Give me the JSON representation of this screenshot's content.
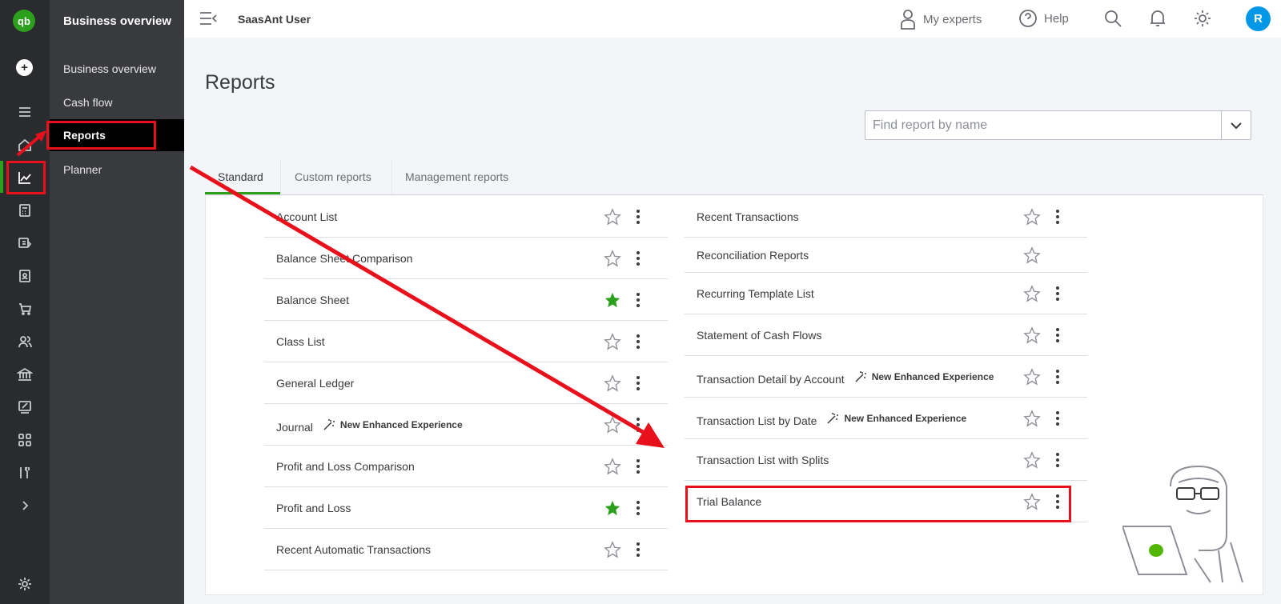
{
  "app": {
    "logo_text": "qb",
    "accent": "#2ca01c",
    "highlight_color": "#e8111b"
  },
  "rail": {
    "icons": [
      "menu-icon",
      "home-icon",
      "reports-chart-icon",
      "calculator-icon",
      "receipt-icon",
      "contacts-icon",
      "cart-icon",
      "people-icon",
      "bank-icon",
      "tax-icon",
      "apps-icon",
      "tools-icon",
      "chevron-right-icon",
      "gear-icon"
    ]
  },
  "subnav": {
    "title": "Business overview",
    "items": [
      {
        "label": "Business overview"
      },
      {
        "label": "Cash flow"
      },
      {
        "label": "Reports"
      },
      {
        "label": "Planner"
      }
    ]
  },
  "topbar": {
    "company": "SaasAnt User",
    "my_experts": "My experts",
    "help": "Help",
    "avatar_initial": "R"
  },
  "main": {
    "title": "Reports",
    "search_placeholder": "Find report by name",
    "tabs": [
      {
        "label": "Standard"
      },
      {
        "label": "Custom reports"
      },
      {
        "label": "Management reports"
      }
    ]
  },
  "reports_left": [
    {
      "name": "Account List",
      "favorite": false,
      "tag": ""
    },
    {
      "name": "Balance Sheet Comparison",
      "favorite": false,
      "tag": ""
    },
    {
      "name": "Balance Sheet",
      "favorite": true,
      "tag": ""
    },
    {
      "name": "Class List",
      "favorite": false,
      "tag": ""
    },
    {
      "name": "General Ledger",
      "favorite": false,
      "tag": ""
    },
    {
      "name": "Journal",
      "favorite": false,
      "tag": "New Enhanced Experience"
    },
    {
      "name": "Profit and Loss Comparison",
      "favorite": false,
      "tag": ""
    },
    {
      "name": "Profit and Loss",
      "favorite": true,
      "tag": ""
    },
    {
      "name": "Recent Automatic Transactions",
      "favorite": false,
      "tag": ""
    }
  ],
  "reports_right": [
    {
      "name": "Recent Transactions",
      "favorite": false,
      "tag": ""
    },
    {
      "name": "Reconciliation Reports",
      "favorite": false,
      "tag": ""
    },
    {
      "name": "Recurring Template List",
      "favorite": false,
      "tag": ""
    },
    {
      "name": "Statement of Cash Flows",
      "favorite": false,
      "tag": ""
    },
    {
      "name": "Transaction Detail by Account",
      "favorite": false,
      "tag": "New Enhanced Experience"
    },
    {
      "name": "Transaction List by Date",
      "favorite": false,
      "tag": "New Enhanced Experience"
    },
    {
      "name": "Transaction List with Splits",
      "favorite": false,
      "tag": ""
    },
    {
      "name": "Trial Balance",
      "favorite": false,
      "tag": ""
    }
  ]
}
